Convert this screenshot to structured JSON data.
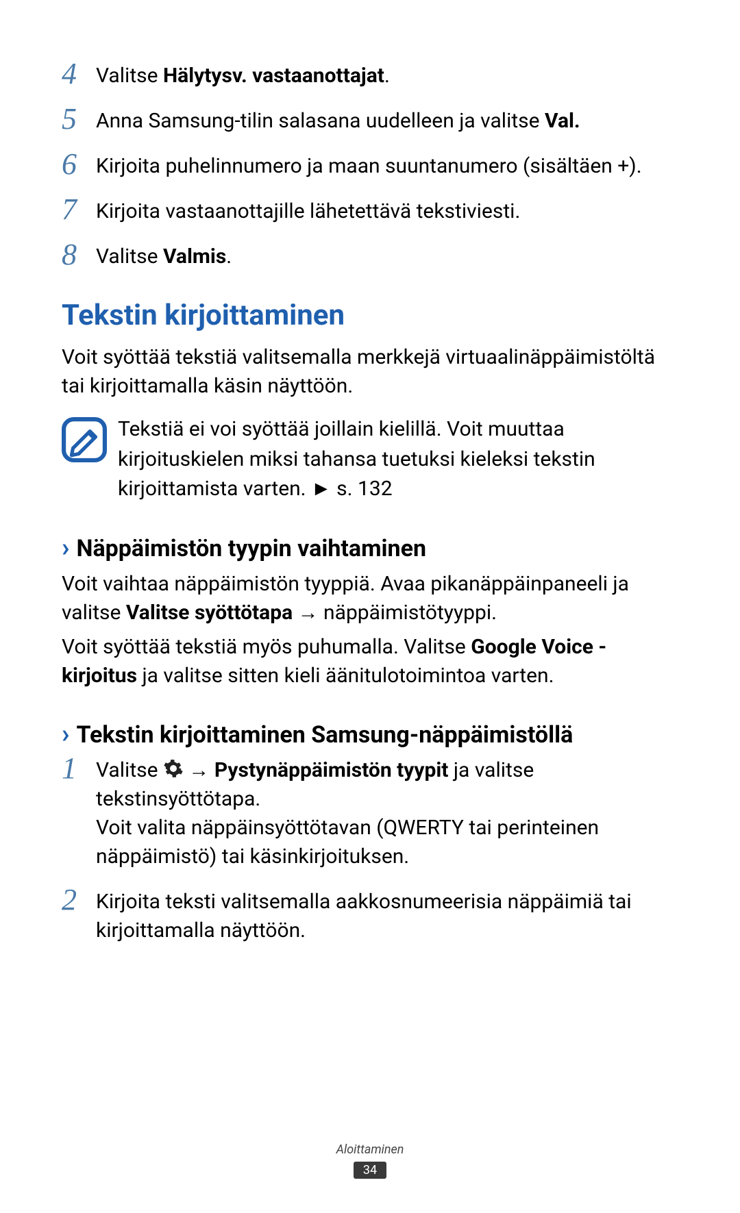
{
  "steps_a": [
    {
      "num": "4",
      "pre": "Valitse ",
      "bold": "Hälytysv. vastaanottajat",
      "post": "."
    },
    {
      "num": "5",
      "pre": "Anna Samsung-tilin salasana uudelleen ja valitse ",
      "bold": "Val.",
      "post": ""
    },
    {
      "num": "6",
      "pre": "Kirjoita puhelinnumero ja maan suuntanumero (sisältäen +).",
      "bold": "",
      "post": ""
    },
    {
      "num": "7",
      "pre": "Kirjoita vastaanottajille lähetettävä tekstiviesti.",
      "bold": "",
      "post": ""
    },
    {
      "num": "8",
      "pre": "Valitse ",
      "bold": "Valmis",
      "post": "."
    }
  ],
  "heading_main": "Tekstin kirjoittaminen",
  "intro_para": "Voit syöttää tekstiä valitsemalla merkkejä virtuaalinäppäimistöltä tai kirjoittamalla käsin näyttöön.",
  "note_text": "Tekstiä ei voi syöttää joillain kielillä. Voit muuttaa kirjoituskielen miksi tahansa tuetuksi kieleksi tekstin kirjoittamista varten. ► s. 132",
  "sub1_title": "Näppäimistön tyypin vaihtaminen",
  "sub1_p1_pre": "Voit vaihtaa näppäimistön tyyppiä. Avaa pikanäppäinpaneeli ja valitse ",
  "sub1_p1_bold": "Valitse syöttötapa",
  "sub1_p1_post": " → näppäimistötyyppi.",
  "sub1_p2_pre": "Voit syöttää tekstiä myös puhumalla. Valitse ",
  "sub1_p2_bold": "Google Voice -kirjoitus",
  "sub1_p2_post": " ja valitse sitten kieli äänitulotoimintoa varten.",
  "sub2_title": "Tekstin kirjoittaminen Samsung-näppäimistöllä",
  "steps_b": {
    "s1_num": "1",
    "s1_pre": "Valitse ",
    "s1_bold": "Pystynäppäimistön tyypit",
    "s1_post": " ja valitse tekstinsyöttötapa.",
    "s1_extra": "Voit valita näppäinsyöttötavan (QWERTY tai perinteinen näppäimistö) tai käsinkirjoituksen.",
    "s2_num": "2",
    "s2_text": "Kirjoita teksti valitsemalla aakkosnumeerisia näppäimiä tai kirjoittamalla näyttöön."
  },
  "footer_label": "Aloittaminen",
  "page_number": "34"
}
